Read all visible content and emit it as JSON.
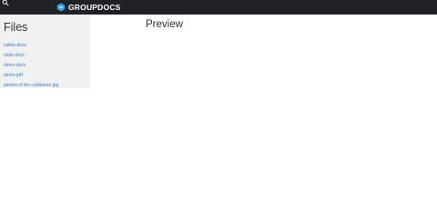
{
  "header": {
    "brand": "GROUPDOCS",
    "icons": [
      "search-icon",
      "groupdocs-logo-icon"
    ],
    "background": "#202124"
  },
  "sidebar": {
    "title": "Files",
    "files": [
      {
        "label": "callee.docx"
      },
      {
        "label": "code.docx"
      },
      {
        "label": "demo.docx"
      },
      {
        "label": "demo.pdf"
      },
      {
        "label": "pirates of the caribbean.jpg"
      }
    ],
    "background": "#f1f1f1",
    "link_color": "#3b7bc8"
  },
  "main": {
    "title": "Preview"
  }
}
